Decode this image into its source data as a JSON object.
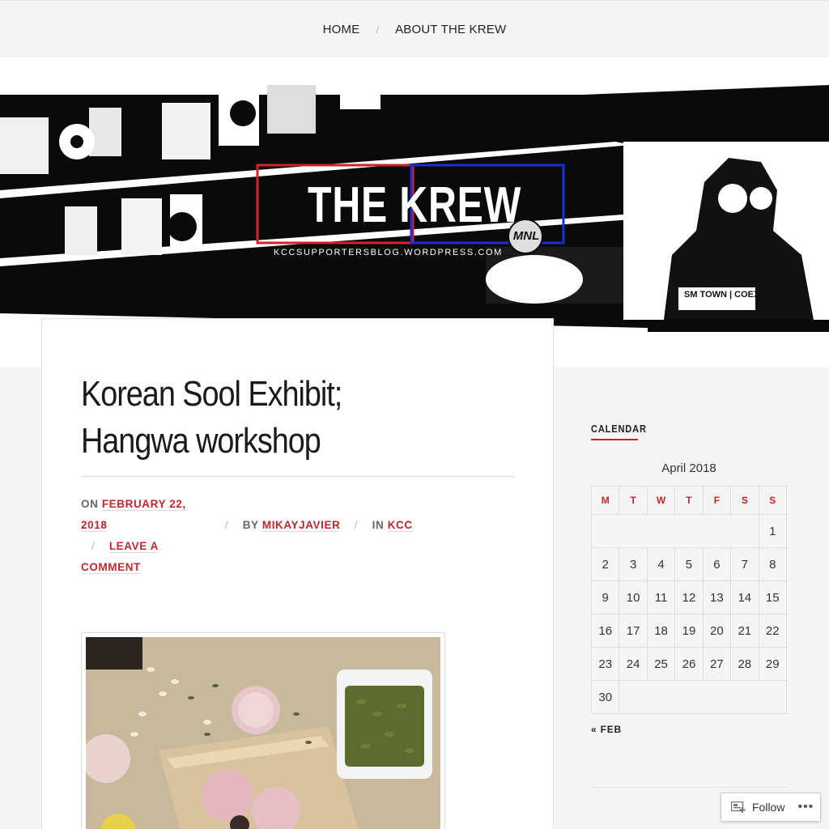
{
  "nav": {
    "items": [
      {
        "label": "HOME"
      },
      {
        "label": "ABOUT THE KREW"
      }
    ],
    "separator": "/"
  },
  "banner": {
    "logo_title": "THE KREW",
    "logo_badge": "MNL",
    "logo_url": "KCCSUPPORTERSBLOG.WORDPRESS.COM",
    "caption": "SM TOWN | COEX"
  },
  "post": {
    "title_line1": "Korean Sool Exhibit;",
    "title_line2": "Hangwa workshop",
    "on_label": "ON",
    "date_line1": "FEBRUARY 22,",
    "date_line2": "2018",
    "by_label": "BY",
    "author": "MIKAYJAVIER",
    "in_label": "IN",
    "category": "KCC",
    "comment_line1": "LEAVE A",
    "comment_line2": "COMMENT",
    "sep": "/"
  },
  "sidebar": {
    "calendar_title": "CALENDAR",
    "caption": "April 2018",
    "weekdays": [
      "M",
      "T",
      "W",
      "T",
      "F",
      "S",
      "S"
    ],
    "weeks": [
      [
        "",
        "",
        "",
        "",
        "",
        "",
        "1"
      ],
      [
        "2",
        "3",
        "4",
        "5",
        "6",
        "7",
        "8"
      ],
      [
        "9",
        "10",
        "11",
        "12",
        "13",
        "14",
        "15"
      ],
      [
        "16",
        "17",
        "18",
        "19",
        "20",
        "21",
        "22"
      ],
      [
        "23",
        "24",
        "25",
        "26",
        "27",
        "28",
        "29"
      ],
      [
        "30"
      ]
    ],
    "prev_link": "« FEB"
  },
  "follow": {
    "label": "Follow",
    "more": "•••"
  },
  "colors": {
    "accent": "#c0272d",
    "logo_red": "#d2232a",
    "logo_blue": "#1b2fd0"
  }
}
